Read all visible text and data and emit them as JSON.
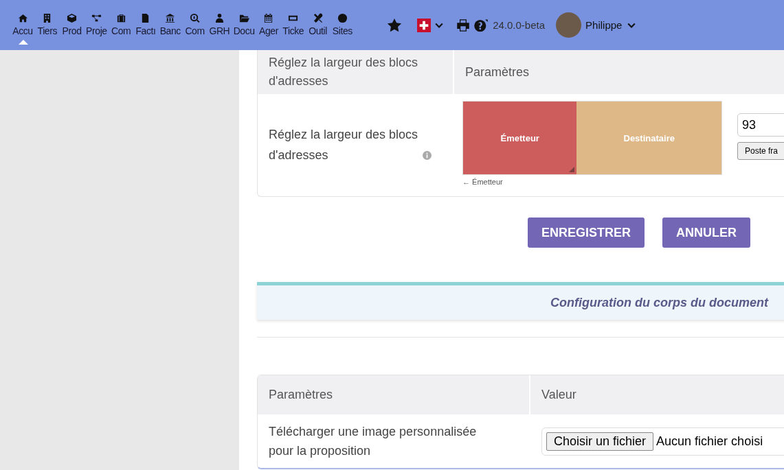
{
  "top_menu": [
    {
      "label": "Accu",
      "selected": true
    },
    {
      "label": "Tiers",
      "selected": false
    },
    {
      "label": "Prod",
      "selected": false
    },
    {
      "label": "Proje",
      "selected": false
    },
    {
      "label": "Com",
      "selected": false
    },
    {
      "label": "Factı",
      "selected": false
    },
    {
      "label": "Banc",
      "selected": false
    },
    {
      "label": "Com",
      "selected": false
    },
    {
      "label": "GRH",
      "selected": false
    },
    {
      "label": "Docu",
      "selected": false
    },
    {
      "label": "Ager",
      "selected": false
    },
    {
      "label": "Ticke",
      "selected": false
    },
    {
      "label": "Outil",
      "selected": false
    },
    {
      "label": "Sites",
      "selected": false
    }
  ],
  "version": "24.0.0-beta",
  "user": {
    "name": "Philippe"
  },
  "address_table": {
    "columns": [
      "Réglez la largeur des blocs d'adresses",
      "Paramètres"
    ],
    "row": {
      "label": "Réglez la largeur des blocs d'adresses",
      "sender_block": "Émetteur",
      "recipient_block": "Destinataire",
      "level": 0.44,
      "caption": "← Émetteur",
      "value": "93",
      "button": "Poste fra"
    }
  },
  "actions": [
    "ENREGISTRER",
    "ANNULER"
  ],
  "section_title": "Configuration du corps du document",
  "body_table": {
    "columns": [
      "Paramètres",
      "Valeur"
    ],
    "row": {
      "label": "Télécharger une image personnalisée pour la proposition",
      "file_button": "Choisir un fichier",
      "file_status": "Aucun fichier choisi"
    }
  }
}
